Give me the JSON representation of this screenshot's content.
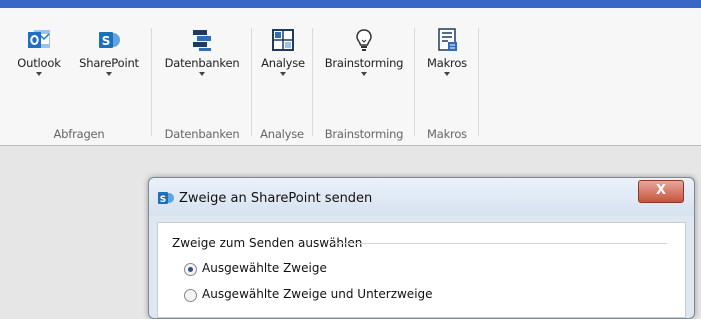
{
  "ribbon": {
    "buttons": [
      {
        "label": "Outlook",
        "icon": "outlook-icon"
      },
      {
        "label": "SharePoint",
        "icon": "sharepoint-icon"
      },
      {
        "label": "Datenbanken",
        "icon": "database-icon"
      },
      {
        "label": "Analyse",
        "icon": "analysis-grid-icon"
      },
      {
        "label": "Brainstorming",
        "icon": "lightbulb-icon"
      },
      {
        "label": "Makros",
        "icon": "macro-document-icon"
      }
    ],
    "groups": [
      {
        "label": "Abfragen"
      },
      {
        "label": "Datenbanken"
      },
      {
        "label": "Analyse"
      },
      {
        "label": "Brainstorming"
      },
      {
        "label": "Makros"
      }
    ]
  },
  "dialog": {
    "title": "Zweige an SharePoint senden",
    "close_label": "X",
    "section_label": "Zweige zum Senden auswählen",
    "options": [
      {
        "label": "Ausgewählte Zweige",
        "selected": true
      },
      {
        "label": "Ausgewählte Zweige und Unterzweige",
        "selected": false
      }
    ]
  },
  "colors": {
    "title_bar": "#3a67c5",
    "outlook_blue": "#1f6fc5",
    "sharepoint_blue": "#1c70b8",
    "close_red": "#c6543e"
  }
}
